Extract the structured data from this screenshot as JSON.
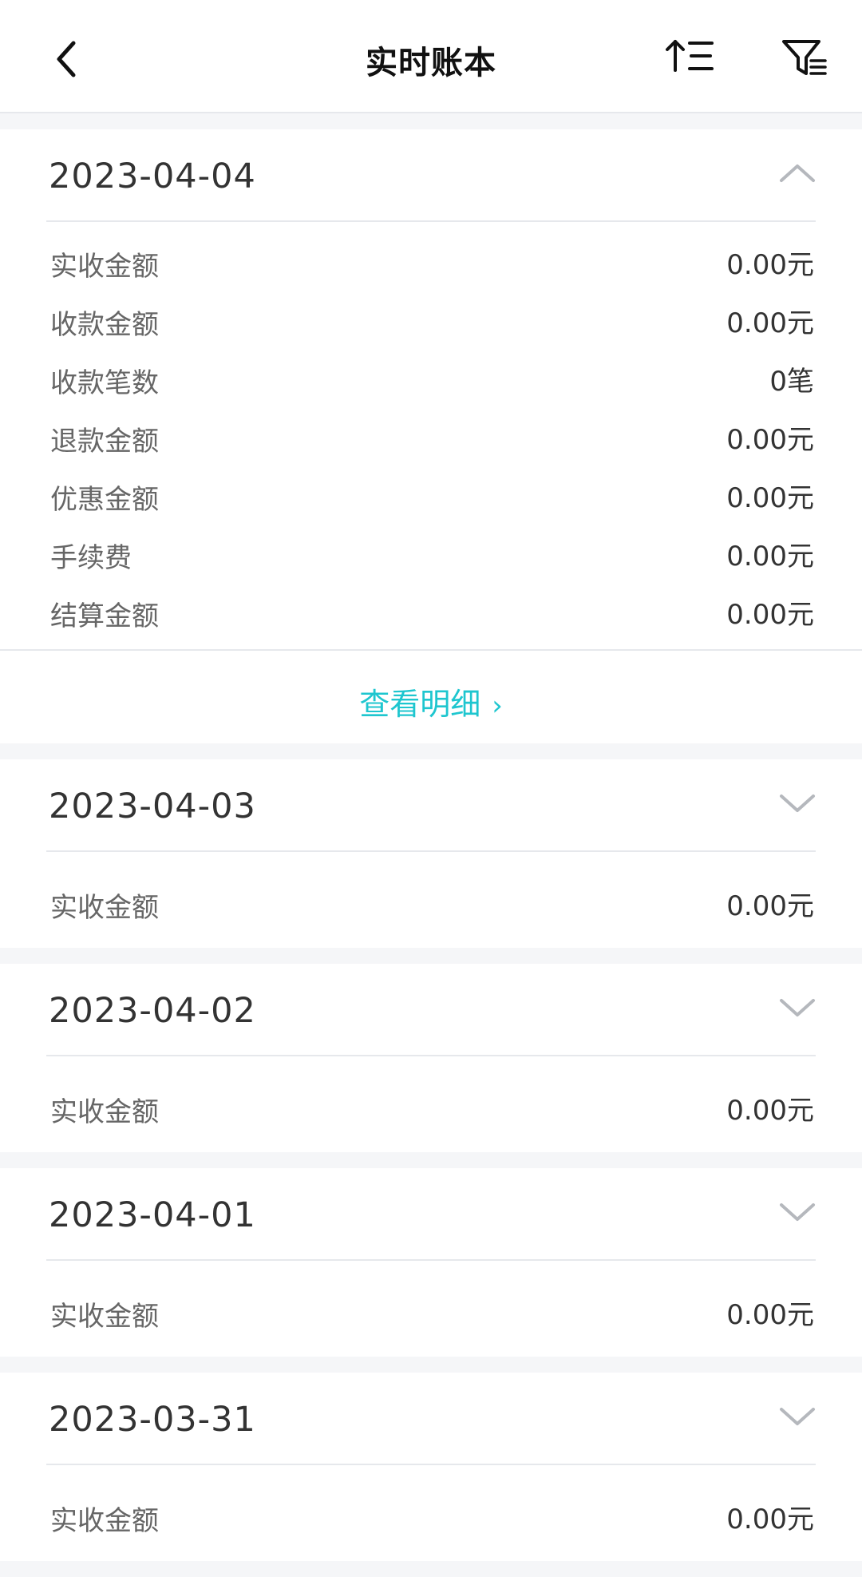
{
  "header": {
    "title": "实时账本",
    "back_icon": "chevron-left-icon",
    "sort_icon": "sort-ascending-icon",
    "filter_icon": "filter-icon"
  },
  "colors": {
    "accent": "#1ec6cf",
    "background": "#f5f6f8",
    "divider": "#e6e8ec"
  },
  "days": [
    {
      "date": "2023-04-04",
      "expanded": true,
      "rows": [
        {
          "label": "实收金额",
          "value": "0.00元"
        },
        {
          "label": "收款金额",
          "value": "0.00元"
        },
        {
          "label": "收款笔数",
          "value": "0笔"
        },
        {
          "label": "退款金额",
          "value": "0.00元"
        },
        {
          "label": "优惠金额",
          "value": "0.00元"
        },
        {
          "label": "手续费",
          "value": "0.00元"
        },
        {
          "label": "结算金额",
          "value": "0.00元"
        }
      ],
      "detail_link": "查看明细"
    },
    {
      "date": "2023-04-03",
      "expanded": false,
      "rows": [
        {
          "label": "实收金额",
          "value": "0.00元"
        }
      ]
    },
    {
      "date": "2023-04-02",
      "expanded": false,
      "rows": [
        {
          "label": "实收金额",
          "value": "0.00元"
        }
      ]
    },
    {
      "date": "2023-04-01",
      "expanded": false,
      "rows": [
        {
          "label": "实收金额",
          "value": "0.00元"
        }
      ]
    },
    {
      "date": "2023-03-31",
      "expanded": false,
      "rows": [
        {
          "label": "实收金额",
          "value": "0.00元"
        }
      ]
    }
  ]
}
